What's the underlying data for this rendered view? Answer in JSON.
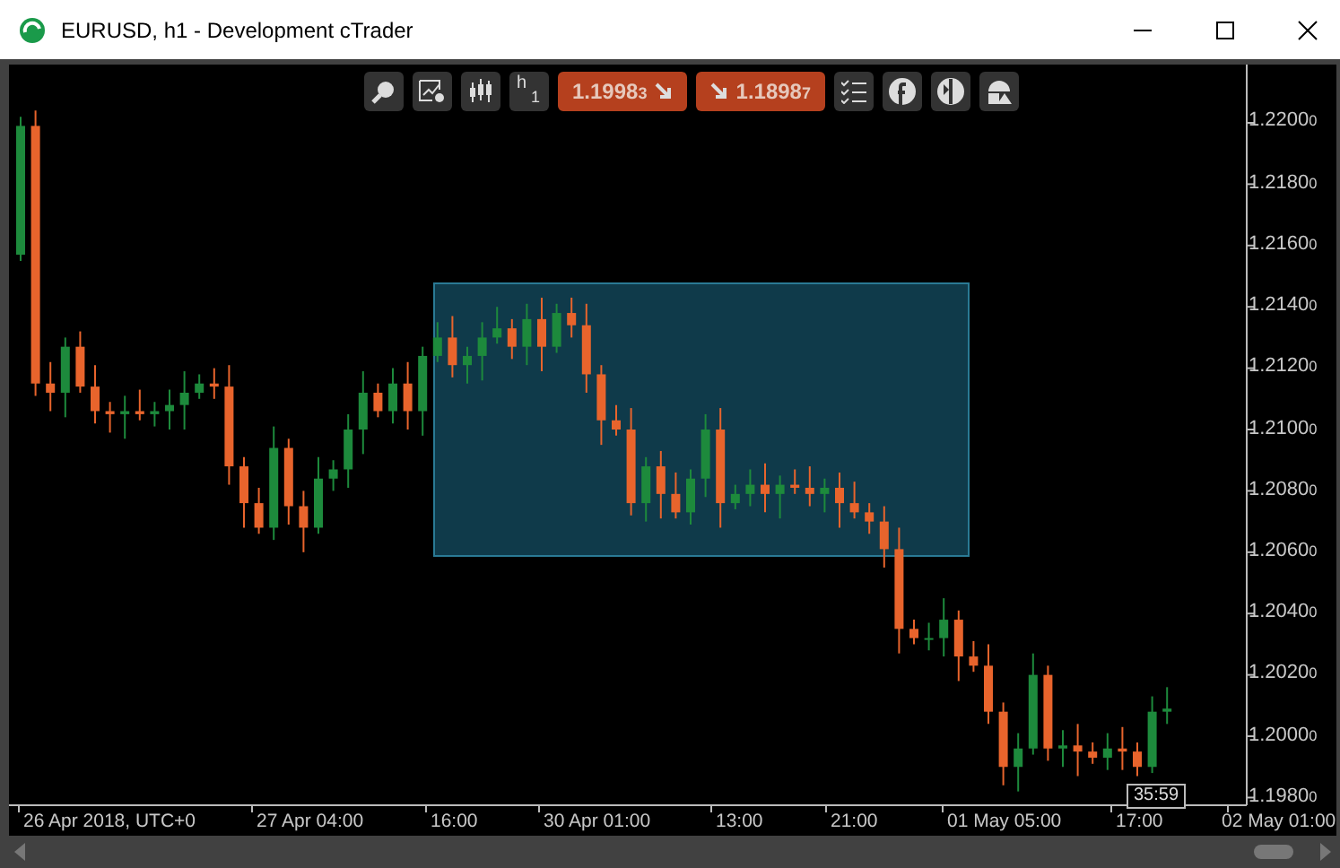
{
  "window": {
    "title": "EURUSD, h1 - Development cTrader"
  },
  "toolbar": {
    "timeframe": {
      "letter": "h",
      "number": "1"
    },
    "sell_price": "1.1998$_{3}$",
    "buy_price": "1.1898$_{7}$"
  },
  "chart": {
    "countdown": "35:59",
    "chart_data": {
      "type": "candlestick",
      "categories": [
        null,
        null,
        null,
        null,
        null,
        null,
        "26 Apr 2018, UTC+0",
        null,
        null,
        null,
        null,
        null,
        null,
        null,
        null,
        null,
        null,
        null,
        null,
        null,
        "27 Apr 04:00",
        null,
        null,
        null,
        null,
        null,
        null,
        null,
        null,
        "16:00",
        null,
        null,
        null,
        null,
        null,
        null,
        null,
        null,
        null,
        "30 Apr 01:00",
        null,
        null,
        null,
        null,
        null,
        null,
        null,
        null,
        "13:00",
        null,
        null,
        null,
        null,
        null,
        null,
        null,
        "21:00",
        null,
        null,
        null,
        null,
        null,
        null,
        null,
        null,
        null,
        "01 May 05:00",
        null,
        null,
        null,
        null,
        null,
        null,
        null,
        null,
        "17:00",
        null,
        null,
        null,
        null,
        null,
        null,
        null,
        null,
        "02 May 01:00"
      ],
      "ohlc": [
        [
          1.2157,
          1.2202,
          1.2155,
          1.2199
        ],
        [
          1.2199,
          1.2204,
          1.2111,
          1.2115
        ],
        [
          1.2115,
          1.2122,
          1.2106,
          1.2112
        ],
        [
          1.2112,
          1.213,
          1.2104,
          1.2127
        ],
        [
          1.2127,
          1.2132,
          1.2112,
          1.2114
        ],
        [
          1.2114,
          1.2121,
          1.2102,
          1.2106
        ],
        [
          1.2106,
          1.2109,
          1.2099,
          1.2105
        ],
        [
          1.2105,
          1.2111,
          1.2097,
          1.2106
        ],
        [
          1.2106,
          1.2113,
          1.2103,
          1.2105
        ],
        [
          1.2105,
          1.2109,
          1.2101,
          1.2106
        ],
        [
          1.2106,
          1.2113,
          1.21,
          1.2108
        ],
        [
          1.2108,
          1.2119,
          1.21,
          1.2112
        ],
        [
          1.2112,
          1.2118,
          1.211,
          1.2115
        ],
        [
          1.2115,
          1.212,
          1.211,
          1.2114
        ],
        [
          1.2114,
          1.2121,
          1.2082,
          1.2088
        ],
        [
          1.2088,
          1.2091,
          1.2068,
          1.2076
        ],
        [
          1.2076,
          1.2081,
          1.2066,
          1.2068
        ],
        [
          1.2068,
          1.2101,
          1.2064,
          1.2094
        ],
        [
          1.2094,
          1.2097,
          1.2069,
          1.2075
        ],
        [
          1.2075,
          1.208,
          1.206,
          1.2068
        ],
        [
          1.2068,
          1.2091,
          1.2066,
          1.2084
        ],
        [
          1.2084,
          1.209,
          1.208,
          1.2087
        ],
        [
          1.2087,
          1.2105,
          1.2081,
          1.21
        ],
        [
          1.21,
          1.2119,
          1.2092,
          1.2112
        ],
        [
          1.2112,
          1.2115,
          1.2104,
          1.2106
        ],
        [
          1.2106,
          1.212,
          1.2102,
          1.2115
        ],
        [
          1.2115,
          1.2122,
          1.21,
          1.2106
        ],
        [
          1.2106,
          1.2127,
          1.2098,
          1.2124
        ],
        [
          1.2124,
          1.2135,
          1.2122,
          1.213
        ],
        [
          1.213,
          1.2137,
          1.2117,
          1.2121
        ],
        [
          1.2121,
          1.2127,
          1.2115,
          1.2124
        ],
        [
          1.2124,
          1.2135,
          1.2116,
          1.213
        ],
        [
          1.213,
          1.214,
          1.2128,
          1.2133
        ],
        [
          1.2133,
          1.2136,
          1.2123,
          1.2127
        ],
        [
          1.2127,
          1.2141,
          1.2121,
          1.2136
        ],
        [
          1.2136,
          1.2143,
          1.2119,
          1.2127
        ],
        [
          1.2127,
          1.2141,
          1.2125,
          1.2138
        ],
        [
          1.2138,
          1.2143,
          1.213,
          1.2134
        ],
        [
          1.2134,
          1.2141,
          1.2112,
          1.2118
        ],
        [
          1.2118,
          1.2121,
          1.2095,
          1.2103
        ],
        [
          1.2103,
          1.2108,
          1.2098,
          1.21
        ],
        [
          1.21,
          1.2107,
          1.2072,
          1.2076
        ],
        [
          1.2076,
          1.2091,
          1.207,
          1.2088
        ],
        [
          1.2088,
          1.2093,
          1.2071,
          1.2079
        ],
        [
          1.2079,
          1.2086,
          1.2071,
          1.2073
        ],
        [
          1.2073,
          1.2087,
          1.2069,
          1.2084
        ],
        [
          1.2084,
          1.2105,
          1.2078,
          1.21
        ],
        [
          1.21,
          1.2107,
          1.2068,
          1.2076
        ],
        [
          1.2076,
          1.2082,
          1.2074,
          1.2079
        ],
        [
          1.2079,
          1.2087,
          1.2075,
          1.2082
        ],
        [
          1.2082,
          1.2089,
          1.2073,
          1.2079
        ],
        [
          1.2079,
          1.2085,
          1.2071,
          1.2082
        ],
        [
          1.2082,
          1.2087,
          1.2079,
          1.2081
        ],
        [
          1.2081,
          1.2088,
          1.2075,
          1.2079
        ],
        [
          1.2079,
          1.2084,
          1.2073,
          1.2081
        ],
        [
          1.2081,
          1.2086,
          1.2068,
          1.2076
        ],
        [
          1.2076,
          1.2083,
          1.2071,
          1.2073
        ],
        [
          1.2073,
          1.2076,
          1.2066,
          1.207
        ],
        [
          1.207,
          1.2075,
          1.2055,
          1.2061
        ],
        [
          1.2061,
          1.2068,
          1.2027,
          1.2035
        ],
        [
          1.2035,
          1.2038,
          1.203,
          1.2032
        ],
        [
          1.2032,
          1.2037,
          1.2028,
          1.2032
        ],
        [
          1.2032,
          1.2045,
          1.2026,
          1.2038
        ],
        [
          1.2038,
          1.2041,
          1.2018,
          1.2026
        ],
        [
          1.2026,
          1.2031,
          1.2021,
          1.2023
        ],
        [
          1.2023,
          1.203,
          1.2004,
          1.2008
        ],
        [
          1.2008,
          1.2011,
          1.1984,
          1.199
        ],
        [
          1.199,
          1.2001,
          1.1982,
          1.1996
        ],
        [
          1.1996,
          1.2027,
          1.1994,
          1.202
        ],
        [
          1.202,
          1.2023,
          1.1992,
          1.1996
        ],
        [
          1.1996,
          1.2002,
          1.199,
          1.1997
        ],
        [
          1.1997,
          1.2004,
          1.1987,
          1.1995
        ],
        [
          1.1995,
          1.1998,
          1.1991,
          1.1993
        ],
        [
          1.1993,
          1.2001,
          1.1989,
          1.1996
        ],
        [
          1.1996,
          1.2003,
          1.1989,
          1.1995
        ],
        [
          1.1995,
          1.1998,
          1.1987,
          1.199
        ],
        [
          1.199,
          1.2013,
          1.1988,
          1.2008
        ],
        [
          1.2008,
          1.2016,
          1.2004,
          1.2009
        ],
        null,
        null,
        null,
        null,
        null,
        null,
        null
      ],
      "ylim": [
        1.19775,
        1.2219
      ],
      "yticks": [
        {
          "value": 1.22,
          "label": "1.22000"
        },
        {
          "value": 1.218,
          "label": "1.21800"
        },
        {
          "value": 1.216,
          "label": "1.21600"
        },
        {
          "value": 1.214,
          "label": "1.21400"
        },
        {
          "value": 1.212,
          "label": "1.21200"
        },
        {
          "value": 1.21,
          "label": "1.21000"
        },
        {
          "value": 1.208,
          "label": "1.20800"
        },
        {
          "value": 1.206,
          "label": "1.20600"
        },
        {
          "value": 1.204,
          "label": "1.20400"
        },
        {
          "value": 1.202,
          "label": "1.20200"
        },
        {
          "value": 1.2,
          "label": "1.20000"
        },
        {
          "value": 1.198,
          "label": "1.19800"
        }
      ]
    }
  }
}
